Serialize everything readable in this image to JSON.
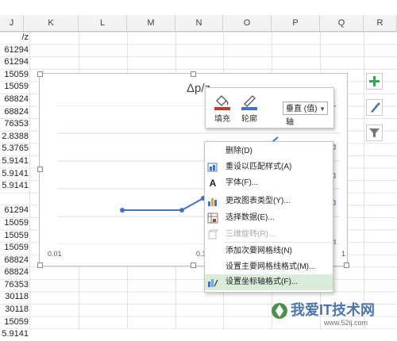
{
  "columns": [
    "J",
    "K",
    "L",
    "M",
    "N",
    "O",
    "P",
    "Q",
    "R"
  ],
  "cells": [
    "/z",
    "61294",
    "61294",
    "15059",
    "15059",
    "68824",
    "68824",
    "76353",
    "2.8388",
    "5.3765",
    "5.9141",
    "5.9141",
    "5.9141",
    "",
    "61294",
    "15059",
    "15059",
    "15059",
    "68824",
    "68824",
    "76353",
    "30118",
    "30118",
    "15059",
    "5.9141"
  ],
  "chart": {
    "title": "Δp/z",
    "x_ticks": [
      "0.01",
      "0.1",
      "1"
    ]
  },
  "chart_data": {
    "type": "line",
    "title": "Δp/z",
    "x_scale": "log",
    "x_ticks": [
      "0.01",
      "0.1",
      "1"
    ],
    "series": [
      {
        "values_visible_points": 4
      }
    ]
  },
  "mini_toolbar": {
    "fill_label": "填充",
    "outline_label": "轮廓",
    "selector_value": "垂直 (值) 轴"
  },
  "context_menu": {
    "items": [
      {
        "label": "删除(D)"
      },
      {
        "label": "重设以匹配样式(A)"
      },
      {
        "label": "字体(F)..."
      },
      {
        "label": "更改图表类型(Y)..."
      },
      {
        "label": "选择数据(E)..."
      },
      {
        "label": "三维旋转(R)..."
      },
      {
        "label": "添加次要网格线(N)"
      },
      {
        "label": "设置主要网格线格式(M)..."
      },
      {
        "label": "设置坐标轴格式(F)..."
      }
    ]
  },
  "watermark": {
    "text": "我爱IT技术网",
    "url": "www.52ij.com"
  },
  "colors": {
    "accent": "#4472c4",
    "highlight": "#d9ecd9",
    "plus_green": "#3aa35a"
  }
}
